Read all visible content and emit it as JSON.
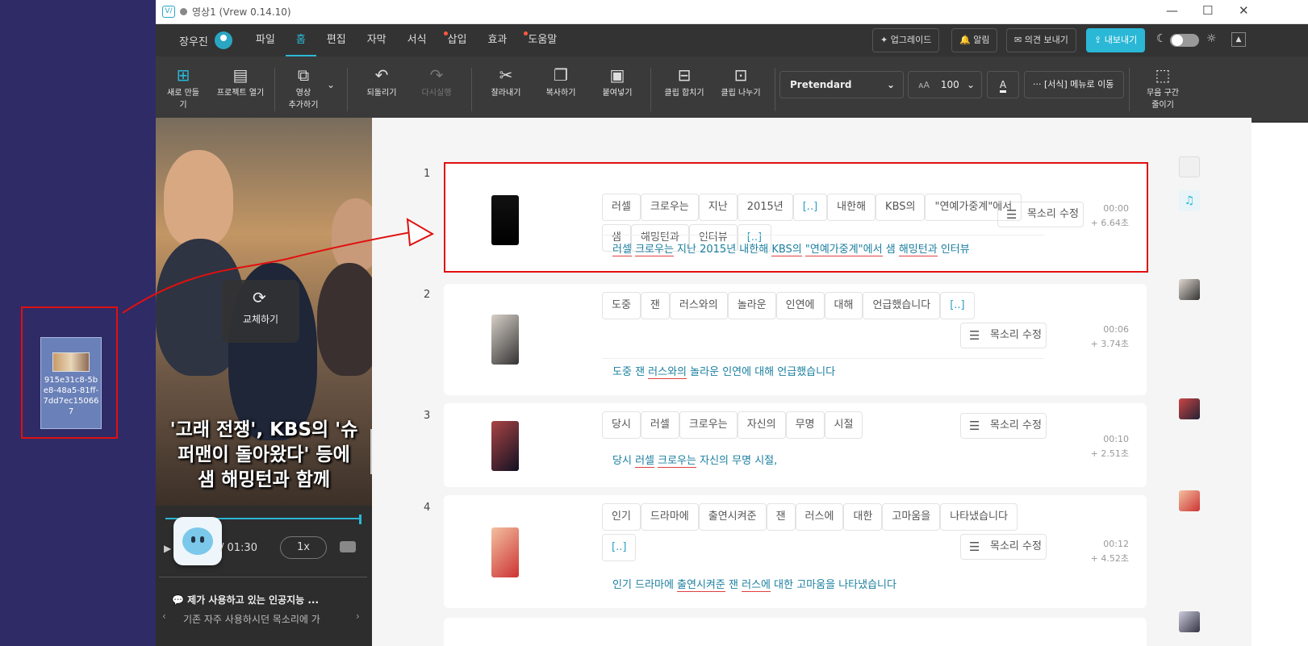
{
  "desktop": {
    "file_name": "915e31c8-5be8-48a5-81ff-7dd7ec150667"
  },
  "window": {
    "logo": "V/",
    "title": "영상1 (Vrew 0.14.10)",
    "minimize": "—",
    "maximize": "☐",
    "close": "✕"
  },
  "menu": {
    "user": "장우진",
    "tabs": [
      "파일",
      "홈",
      "편집",
      "자막",
      "서식",
      "삽입",
      "효과",
      "도움말"
    ],
    "active": "홈",
    "upgrade": "✦ 업그레이드",
    "alarm": "🔔 알림",
    "feedback": "✉ 의견 보내기",
    "export": "⇪ 내보내기"
  },
  "toolbar": {
    "new": "새로 만들기",
    "open": "프로젝트 열기",
    "add_video": "영상\n추가하기",
    "undo": "되돌리기",
    "redo": "다시실행",
    "cut": "잘라내기",
    "copy": "복사하기",
    "paste": "붙여넣기",
    "merge": "클립 합치기",
    "split": "클립 나누기",
    "font": "Pretendard",
    "size": "100",
    "size_icon": "ᴀA",
    "color_letter": "A",
    "format_menu": "··· [서식] 메뉴로 이동",
    "silence": "무음 구간\n줄이기"
  },
  "preview": {
    "replace": "교체하기",
    "caption": "'고래 전쟁', KBS의 '슈\n퍼맨이 돌아왔다' 등에\n샘 해밍턴과 함께",
    "time": "/ 01:30",
    "speed": "1x",
    "notice_title": "제가 사용하고 있는 인공지능 ...",
    "notice_text": "기존 자주 사용하시던 목소리에 가"
  },
  "voice_label": "목소리 수정",
  "clips": [
    {
      "num": "1",
      "words": [
        "러셀",
        "크로우는",
        "지난",
        "2015년",
        "[..]",
        "내한해",
        "KBS의",
        "\"연예가중계\"에서",
        "샘",
        "해밍턴과",
        "인터뷰",
        "[..]"
      ],
      "sub": [
        {
          "t": "러셀",
          "u": true
        },
        {
          "t": "크로우는",
          "u": true
        },
        {
          "t": "지난",
          "u": false
        },
        {
          "t": "2015년",
          "u": false
        },
        {
          "t": "내한해",
          "u": false
        },
        {
          "t": "KBS의",
          "u": true
        },
        {
          "t": "\"연예가중계\"에서",
          "u": true
        },
        {
          "t": "샘",
          "u": false
        },
        {
          "t": "해밍턴과",
          "u": true
        },
        {
          "t": "인터뷰",
          "u": false
        }
      ],
      "start": "00:00",
      "dur": "+ 6.64초"
    },
    {
      "num": "2",
      "words": [
        "도중",
        "잰",
        "러스와의",
        "놀라운",
        "인연에",
        "대해",
        "언급했습니다",
        "[..]"
      ],
      "sub": [
        {
          "t": "도중",
          "u": false
        },
        {
          "t": "잰",
          "u": false
        },
        {
          "t": "러스와의",
          "u": true
        },
        {
          "t": "놀라운",
          "u": false
        },
        {
          "t": "인연에",
          "u": false
        },
        {
          "t": "대해",
          "u": false
        },
        {
          "t": "언급했습니다",
          "u": false
        }
      ],
      "start": "00:06",
      "dur": "+ 3.74초"
    },
    {
      "num": "3",
      "words": [
        "당시",
        "러셀",
        "크로우는",
        "자신의",
        "무명",
        "시절"
      ],
      "sub": [
        {
          "t": "당시",
          "u": false
        },
        {
          "t": "러셀",
          "u": true
        },
        {
          "t": "크로우는",
          "u": true
        },
        {
          "t": "자신의",
          "u": false
        },
        {
          "t": "무명",
          "u": false
        },
        {
          "t": "시절,",
          "u": false
        }
      ],
      "start": "00:10",
      "dur": "+ 2.51초"
    },
    {
      "num": "4",
      "words": [
        "인기",
        "드라마에",
        "출연시켜준",
        "잰",
        "러스에",
        "대한",
        "고마움을",
        "나타냈습니다",
        "[..]"
      ],
      "sub": [
        {
          "t": "인기",
          "u": false
        },
        {
          "t": "드라마에",
          "u": false
        },
        {
          "t": "출연시켜준",
          "u": true
        },
        {
          "t": "잰",
          "u": false
        },
        {
          "t": "러스에",
          "u": true
        },
        {
          "t": "대한",
          "u": false
        },
        {
          "t": "고마움을",
          "u": false
        },
        {
          "t": "나타냈습니다",
          "u": false
        }
      ],
      "start": "00:12",
      "dur": "+ 4.52초"
    }
  ],
  "colors": {
    "accent": "#2ab8d6",
    "annotation": "#e01010"
  }
}
